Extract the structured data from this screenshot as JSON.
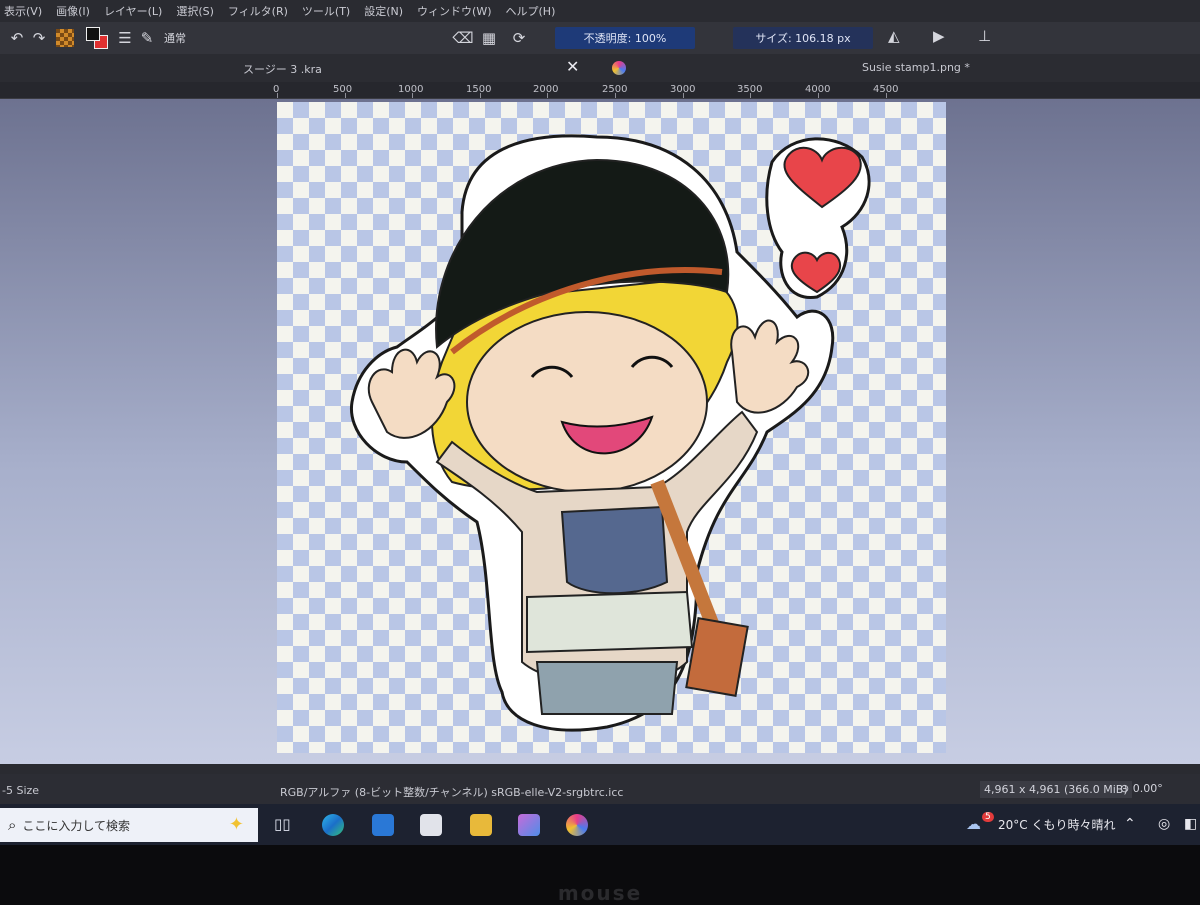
{
  "menu": [
    "表示(V)",
    "画像(I)",
    "レイヤー(L)",
    "選択(S)",
    "フィルタ(R)",
    "ツール(T)",
    "設定(N)",
    "ウィンドウ(W)",
    "ヘルプ(H)"
  ],
  "toolbar": {
    "blend_mode": "通常",
    "opacity": "不透明度: 100%",
    "size": "サイズ: 106.18 px"
  },
  "tabs": {
    "doc1": "スージー 3 .kra",
    "doc2": "Susie stamp1.png *"
  },
  "ruler": [
    "0",
    "500",
    "1000",
    "1500",
    "2000",
    "2500",
    "3000",
    "3500",
    "4000",
    "4500"
  ],
  "status": {
    "brush": "-5 Size",
    "color_profile": "RGB/アルファ (8-ビット整数/チャンネル)  sRGB-elle-V2-srgbtrc.icc",
    "image_size": "4,961 x 4,961 (366.0 MiB)",
    "rotation": "0.00°"
  },
  "taskbar": {
    "search_placeholder": "ここに入力して検索",
    "weather": "20°C  くもり時々晴れ",
    "weather_badge": "5"
  },
  "bezel_brand": "mouse"
}
